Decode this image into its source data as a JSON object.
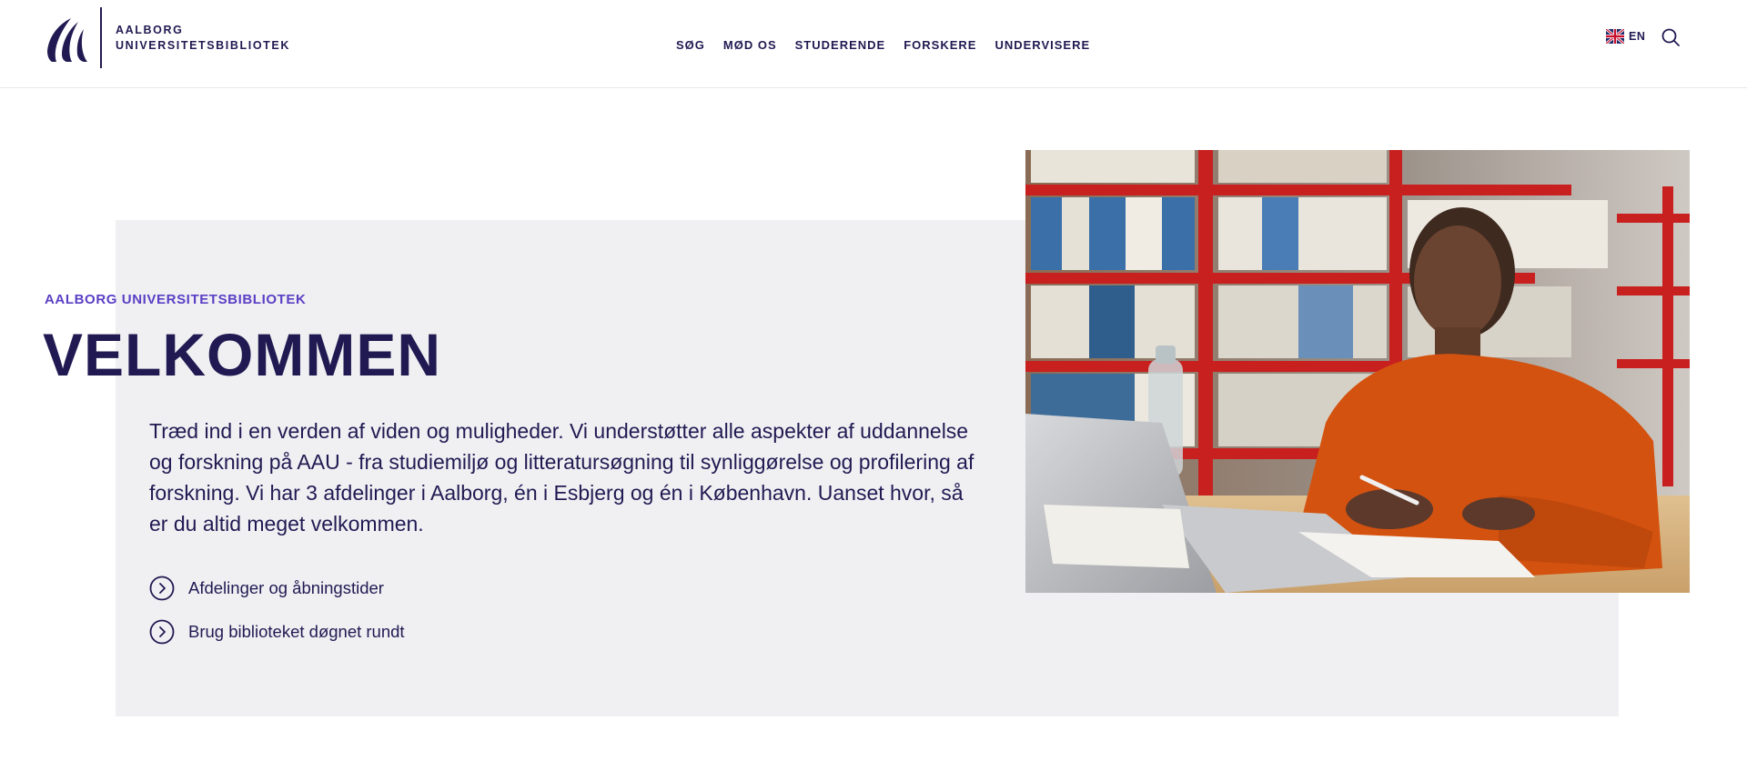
{
  "header": {
    "logo_line1": "AALBORG",
    "logo_line2": "UNIVERSITETSBIBLIOTEK",
    "nav": [
      {
        "label": "SØG"
      },
      {
        "label": "MØD OS"
      },
      {
        "label": "STUDERENDE"
      },
      {
        "label": "FORSKERE"
      },
      {
        "label": "UNDERVISERE"
      }
    ],
    "language_label": "EN"
  },
  "hero": {
    "eyebrow": "AALBORG UNIVERSITETSBIBLIOTEK",
    "title": "VELKOMMEN",
    "intro": "Træd ind i en verden af viden og muligheder. Vi understøtter alle aspekter af uddannelse og forskning på AAU - fra studiemiljø og litteratursøgning til synliggørelse og profilering af forskning. Vi har 3 afdelinger i Aalborg, én i Esbjerg og én i København. Uanset hvor, så er du altid meget velkommen.",
    "links": [
      {
        "label": "Afdelinger og åbningstider",
        "icon": "chevron-circle-icon"
      },
      {
        "label": "Brug biblioteket døgnet rundt",
        "icon": "chevron-circle-icon"
      }
    ],
    "photo_subject": "Student working on a laptop in front of library bookshelves"
  },
  "colors": {
    "brand_navy": "#211a52",
    "accent_purple": "#5a3fc4",
    "panel_background": "#f0f0f3",
    "shelf_red": "#c8201f",
    "sweater_orange": "#d4520f"
  }
}
